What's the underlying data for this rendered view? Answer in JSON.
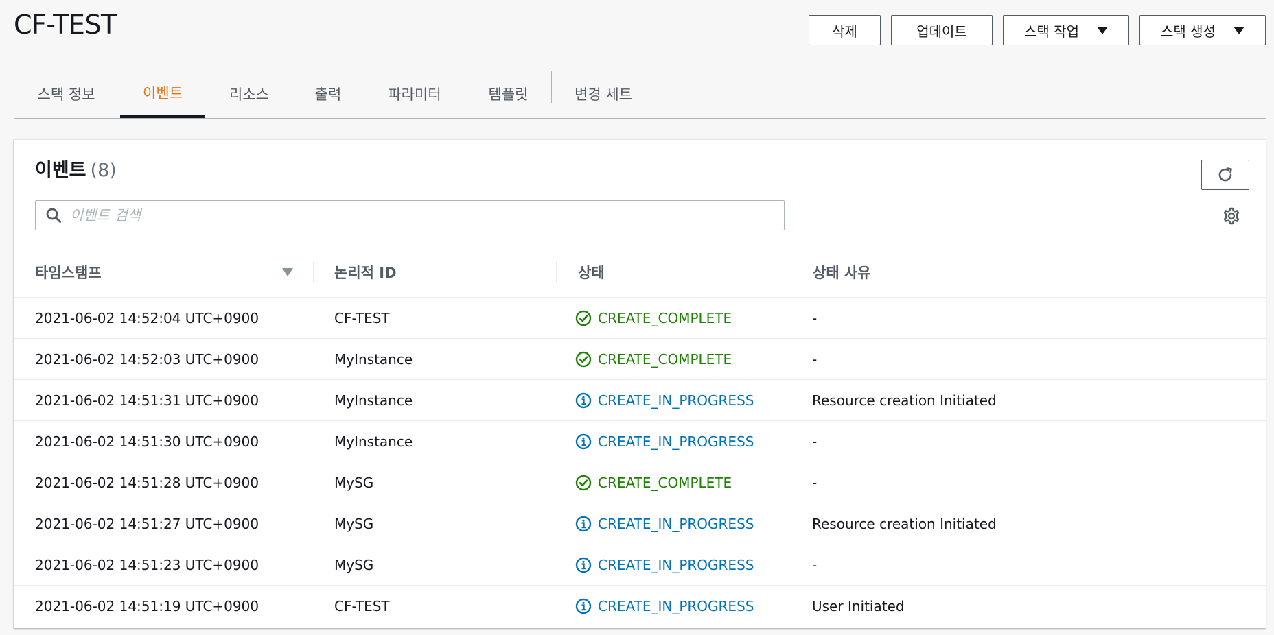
{
  "header": {
    "title": "CF-TEST",
    "buttons": {
      "delete": "삭제",
      "update": "업데이트",
      "stack_action": "스택 작업",
      "create_stack": "스택 생성"
    }
  },
  "tabs": [
    {
      "label": "스택 정보",
      "active": false
    },
    {
      "label": "이벤트",
      "active": true
    },
    {
      "label": "리소스",
      "active": false
    },
    {
      "label": "출력",
      "active": false
    },
    {
      "label": "파라미터",
      "active": false
    },
    {
      "label": "템플릿",
      "active": false
    },
    {
      "label": "변경 세트",
      "active": false
    }
  ],
  "events": {
    "title": "이벤트",
    "count": "(8)",
    "search_placeholder": "이벤트 검색",
    "columns": {
      "timestamp": "타임스탬프",
      "logical_id": "논리적 ID",
      "status": "상태",
      "reason": "상태 사유"
    },
    "rows": [
      {
        "timestamp": "2021-06-02 14:52:04 UTC+0900",
        "logical_id": "CF-TEST",
        "status": "CREATE_COMPLETE",
        "status_type": "complete",
        "reason": "-"
      },
      {
        "timestamp": "2021-06-02 14:52:03 UTC+0900",
        "logical_id": "MyInstance",
        "status": "CREATE_COMPLETE",
        "status_type": "complete",
        "reason": "-"
      },
      {
        "timestamp": "2021-06-02 14:51:31 UTC+0900",
        "logical_id": "MyInstance",
        "status": "CREATE_IN_PROGRESS",
        "status_type": "progress",
        "reason": "Resource creation Initiated"
      },
      {
        "timestamp": "2021-06-02 14:51:30 UTC+0900",
        "logical_id": "MyInstance",
        "status": "CREATE_IN_PROGRESS",
        "status_type": "progress",
        "reason": "-"
      },
      {
        "timestamp": "2021-06-02 14:51:28 UTC+0900",
        "logical_id": "MySG",
        "status": "CREATE_COMPLETE",
        "status_type": "complete",
        "reason": "-"
      },
      {
        "timestamp": "2021-06-02 14:51:27 UTC+0900",
        "logical_id": "MySG",
        "status": "CREATE_IN_PROGRESS",
        "status_type": "progress",
        "reason": "Resource creation Initiated"
      },
      {
        "timestamp": "2021-06-02 14:51:23 UTC+0900",
        "logical_id": "MySG",
        "status": "CREATE_IN_PROGRESS",
        "status_type": "progress",
        "reason": "-"
      },
      {
        "timestamp": "2021-06-02 14:51:19 UTC+0900",
        "logical_id": "CF-TEST",
        "status": "CREATE_IN_PROGRESS",
        "status_type": "progress",
        "reason": "User Initiated"
      }
    ]
  },
  "colors": {
    "active_tab": "#ec7211",
    "complete": "#1d8102",
    "in_progress": "#0073bb"
  },
  "icons": {
    "complete": "check-circle-icon",
    "progress": "info-circle-icon",
    "refresh": "refresh-icon",
    "settings": "gear-icon",
    "search": "search-icon"
  }
}
